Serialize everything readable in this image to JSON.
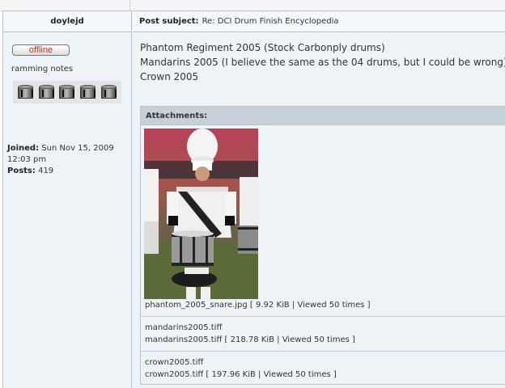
{
  "post": {
    "author": "doylejd",
    "subject_label": "Post subject:",
    "subject": "Re: DCI Drum Finish Encyclopedia",
    "status_label": "offline",
    "rank": "ramming notes",
    "joined_label": "Joined:",
    "joined_value": "Sun Nov 15, 2009",
    "joined_time": "12:03 pm",
    "posts_label": "Posts:",
    "posts_value": "419",
    "body_lines": [
      "Phantom Regiment 2005 (Stock Carbonply drums)",
      "Mandarins 2005 (I believe the same as the 04 drums, but I could be wrong)",
      "Crown 2005"
    ]
  },
  "attachments": {
    "header": "Attachments:",
    "items": [
      {
        "caption": "phantom_2005_snare.jpg [ 9.92 KiB | Viewed 50 times ]"
      },
      {
        "filename": "mandarins2005.tiff",
        "caption": "mandarins2005.tiff [ 218.78 KiB | Viewed 50 times ]"
      },
      {
        "filename": "crown2005.tiff",
        "caption": "crown2005.tiff [ 197.96 KiB | Viewed 50 times ]"
      }
    ]
  },
  "colors": {
    "post_bg": "#eef3f8",
    "border": "#b7c3cc",
    "attach_header_bg": "#c7d0d7",
    "offline_text": "#cc2b20"
  },
  "icons": [
    "drum-rank-icon",
    "drum-rank-icon",
    "drum-rank-icon",
    "drum-rank-icon",
    "drum-rank-icon"
  ]
}
